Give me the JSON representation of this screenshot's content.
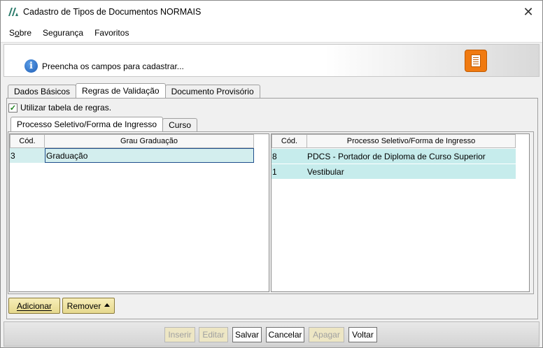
{
  "window": {
    "title": "Cadastro de Tipos de Documentos NORMAIS",
    "close_glyph": "✕"
  },
  "menu": {
    "items": [
      {
        "label": "Sobre",
        "mnemonic": "o"
      },
      {
        "label": "Segurança"
      },
      {
        "label": "Favoritos"
      }
    ]
  },
  "banner": {
    "message": "Preencha os campos para cadastrar...",
    "info_icon": "info-icon",
    "doc_icon": "document-icon"
  },
  "outer_tabs": [
    {
      "label": "Dados Básicos",
      "active": false
    },
    {
      "label": "Regras de Validação",
      "active": true
    },
    {
      "label": "Documento Provisório",
      "active": false
    }
  ],
  "use_rules_checkbox": {
    "label": "Utilizar tabela de regras.",
    "checked": true
  },
  "inner_tabs": [
    {
      "label": "Processo Seletivo/Forma de Ingresso",
      "active": true
    },
    {
      "label": "Curso",
      "active": false
    }
  ],
  "left_grid": {
    "columns": [
      "Cód.",
      "Grau Graduação"
    ],
    "rows": [
      {
        "cod": "3",
        "name": "Graduação"
      }
    ]
  },
  "right_grid": {
    "columns": [
      "Cód.",
      "Processo Seletivo/Forma de Ingresso"
    ],
    "rows": [
      {
        "cod": "8",
        "name": "PDCS - Portador de Diploma de Curso Superior"
      },
      {
        "cod": "1",
        "name": "Vestibular"
      }
    ]
  },
  "actions": {
    "add": "Adicionar",
    "remove": "Remover"
  },
  "footer": {
    "insert": "Inserir",
    "edit": "Editar",
    "save": "Salvar",
    "cancel": "Cancelar",
    "delete": "Apagar",
    "back": "Voltar"
  },
  "colors": {
    "accent_orange": "#f07a10",
    "row_highlight": "#d3eeee",
    "button_gold": "#e6d98e"
  }
}
